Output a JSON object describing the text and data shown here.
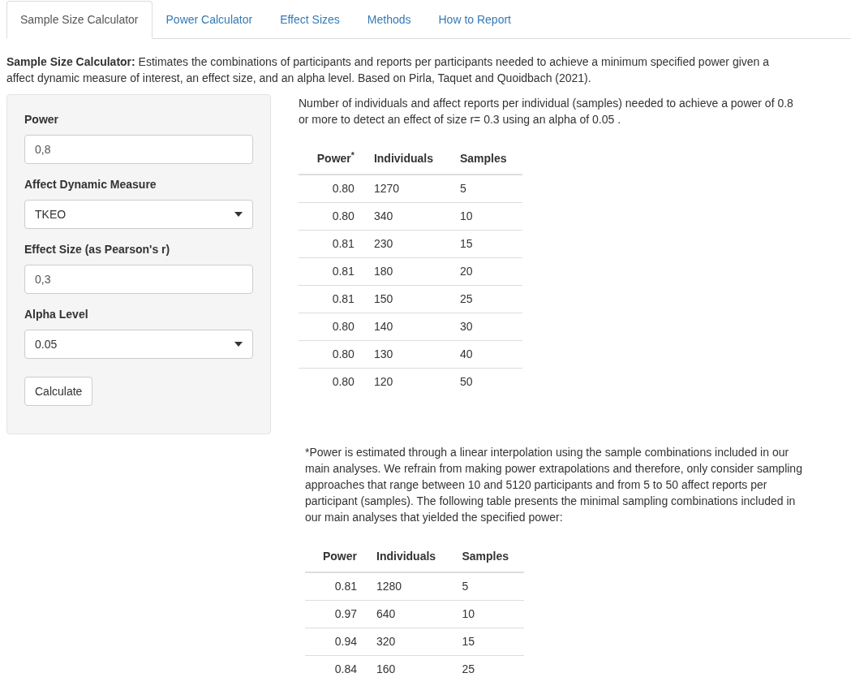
{
  "tabs": [
    {
      "label": "Sample Size Calculator",
      "selected": true
    },
    {
      "label": "Power Calculator",
      "selected": false
    },
    {
      "label": "Effect Sizes",
      "selected": false
    },
    {
      "label": "Methods",
      "selected": false
    },
    {
      "label": "How to Report",
      "selected": false
    }
  ],
  "intro": {
    "lines": [
      "**Sample Size Calculator:** Estimates the combinations of participants and reports per participants needed to achieve a minimum specified power given a",
      "affect dynamic measure of interest, an effect size, and an alpha level. Based on Pirla, Taquet and Quoidbach (2021)."
    ]
  },
  "sidebar": {
    "fields": [
      {
        "kind": "input",
        "label": "Power",
        "value": "0,8"
      },
      {
        "kind": "select",
        "label": "Affect Dynamic Measure",
        "value": "TKEO"
      },
      {
        "kind": "input",
        "label": "Effect Size (as Pearson's r)",
        "value": "0,3"
      },
      {
        "kind": "select",
        "label": "Alpha Level",
        "value": "0.05"
      }
    ],
    "button": "Calculate"
  },
  "result": {
    "lines": [
      "Number of individuals and affect reports per individual (samples) needed to achieve a power of 0.8",
      "or more to detect an effect of size r= 0.3 using an alpha of 0.05 ."
    ],
    "table": {
      "columns": [
        "Power$^{*}$",
        "Individuals",
        "Samples"
      ],
      "rows": [
        [
          "0.80",
          "1270",
          "5"
        ],
        [
          "0.80",
          "340",
          "10"
        ],
        [
          "0.81",
          "230",
          "15"
        ],
        [
          "0.81",
          "180",
          "20"
        ],
        [
          "0.81",
          "150",
          "25"
        ],
        [
          "0.80",
          "140",
          "30"
        ],
        [
          "0.80",
          "130",
          "40"
        ],
        [
          "0.80",
          "120",
          "50"
        ]
      ]
    }
  },
  "note": {
    "lines": [
      "*Power is estimated through a linear interpolation using the sample combinations included in our",
      "main analyses. We refrain from making power extrapolations and therefore, only consider sampling",
      "approaches that range between 10 and 5120 participants and from 5 to 50 affect reports per",
      "participant (samples). The following table presents the minimal sampling combinations included in",
      "our main analyses that yielded the specified power:"
    ],
    "table": {
      "columns": [
        "Power",
        "Individuals",
        "Samples"
      ],
      "rows": [
        [
          "0.81",
          "1280",
          "5"
        ],
        [
          "0.97",
          "640",
          "10"
        ],
        [
          "0.94",
          "320",
          "15"
        ],
        [
          "0.84",
          "160",
          "25"
        ]
      ]
    }
  }
}
